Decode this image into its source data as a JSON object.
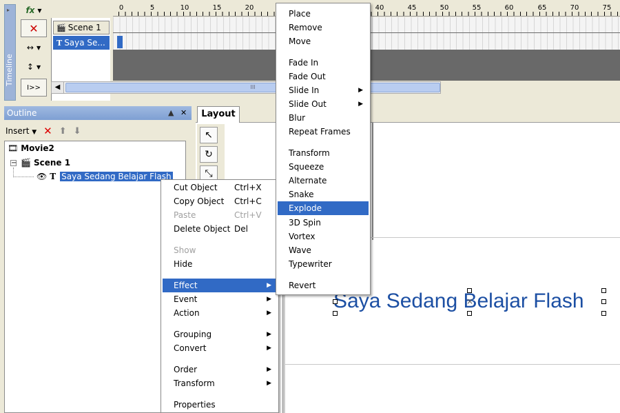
{
  "timeline": {
    "panel_label": "Timeline",
    "tools": [
      "fx-icon",
      "delete-icon",
      "resize-icon",
      "visibility-icon",
      "play-icon"
    ],
    "scenes": [
      {
        "label": "Scene 1",
        "icon": "clapperboard-icon"
      },
      {
        "label": "Saya Se...",
        "icon": "text-icon"
      }
    ],
    "ruler_numbers": [
      "0",
      "5",
      "10",
      "15",
      "20",
      "40",
      "45",
      "50",
      "55",
      "60",
      "65",
      "70",
      "75"
    ],
    "scroll_thumb_label": "III"
  },
  "outline": {
    "title": "Outline",
    "insert_label": "Insert",
    "tree": {
      "movie": "Movie2",
      "scene": "Scene 1",
      "object": "Saya Sedang Belajar Flash"
    }
  },
  "layout": {
    "tab_label": "Layout",
    "stage_text": "Saya Sedang Belajar Flash"
  },
  "context_menu": {
    "items": [
      {
        "label": "Cut Object",
        "shortcut": "Ctrl+X"
      },
      {
        "label": "Copy Object",
        "shortcut": "Ctrl+C"
      },
      {
        "label": "Paste",
        "shortcut": "Ctrl+V",
        "disabled": true
      },
      {
        "label": "Delete Object",
        "shortcut": "Del"
      },
      {
        "label": "Show",
        "disabled": true
      },
      {
        "label": "Hide"
      },
      {
        "label": "Effect",
        "submenu": true,
        "highlighted": true
      },
      {
        "label": "Event",
        "submenu": true
      },
      {
        "label": "Action",
        "submenu": true
      },
      {
        "label": "Grouping",
        "submenu": true
      },
      {
        "label": "Convert",
        "submenu": true
      },
      {
        "label": "Order",
        "submenu": true
      },
      {
        "label": "Transform",
        "submenu": true
      },
      {
        "label": "Properties"
      }
    ]
  },
  "effect_menu": {
    "items": [
      {
        "label": "Place"
      },
      {
        "label": "Remove"
      },
      {
        "label": "Move"
      },
      {
        "label": "Fade In"
      },
      {
        "label": "Fade Out"
      },
      {
        "label": "Slide In",
        "submenu": true
      },
      {
        "label": "Slide Out",
        "submenu": true
      },
      {
        "label": "Blur"
      },
      {
        "label": "Repeat Frames"
      },
      {
        "label": "Transform"
      },
      {
        "label": "Squeeze"
      },
      {
        "label": "Alternate"
      },
      {
        "label": "Snake"
      },
      {
        "label": "Explode",
        "highlighted": true
      },
      {
        "label": "3D Spin"
      },
      {
        "label": "Vortex"
      },
      {
        "label": "Wave"
      },
      {
        "label": "Typewriter"
      },
      {
        "label": "Revert"
      }
    ]
  },
  "colors": {
    "selection": "#316ac5",
    "stage_text": "#1c4fa3",
    "chrome": "#ece9d8"
  }
}
